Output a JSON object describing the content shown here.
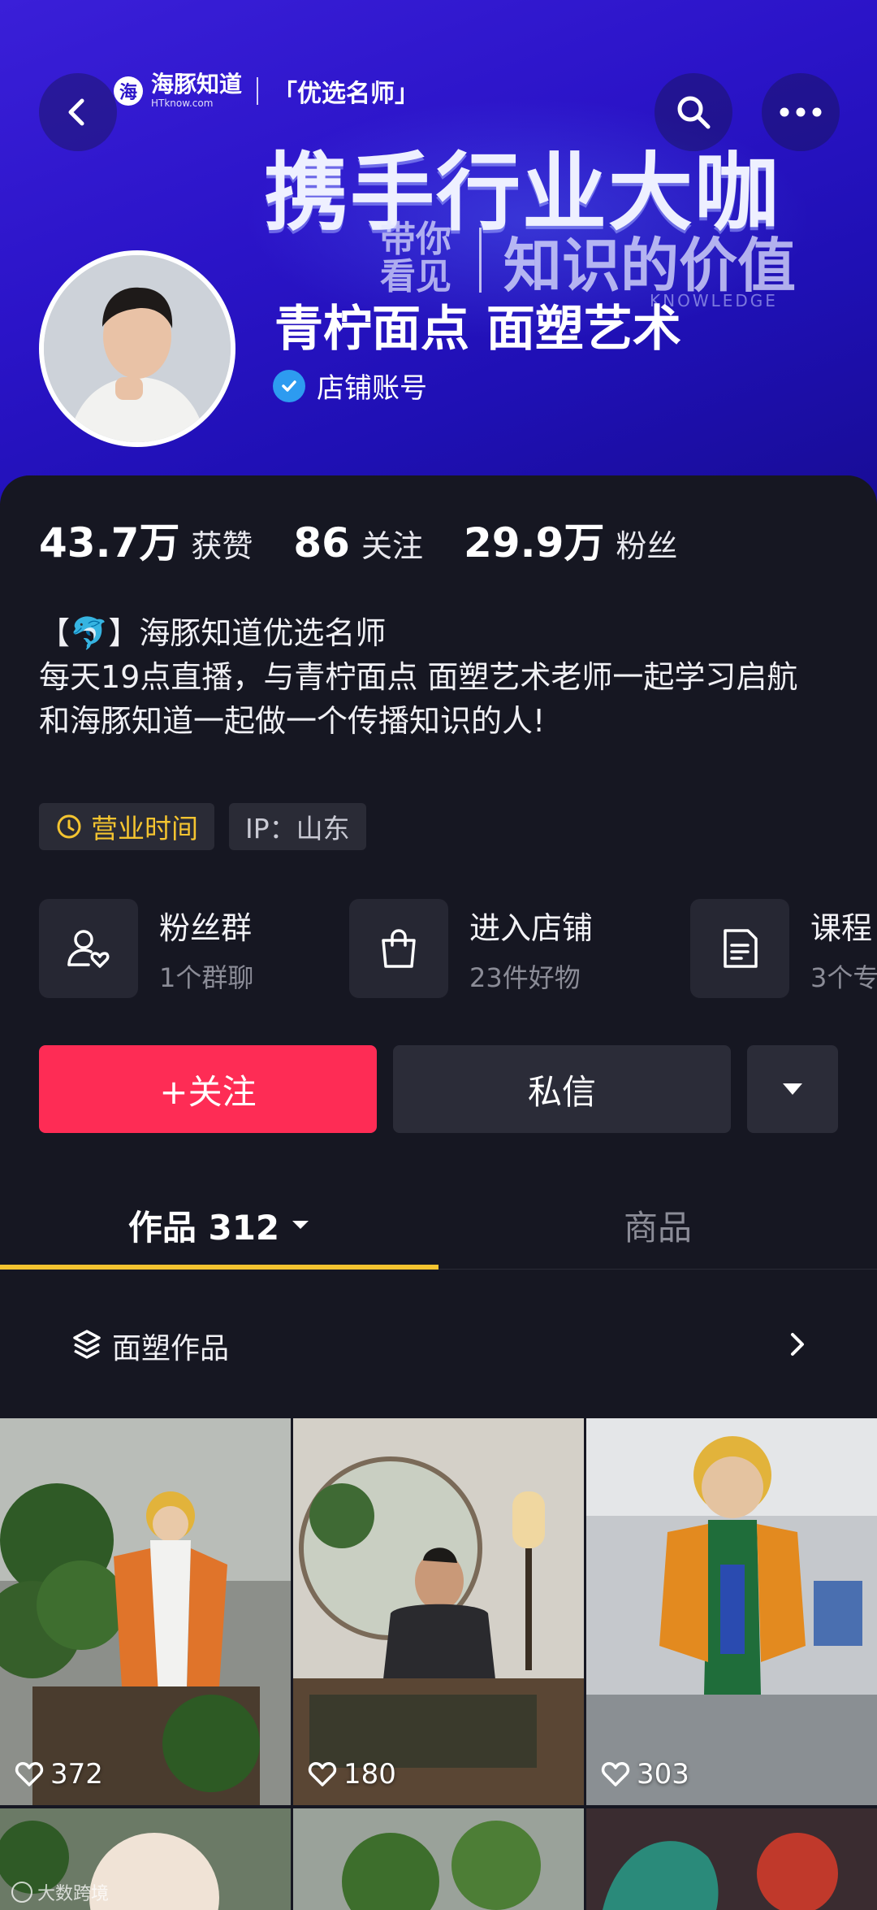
{
  "header": {
    "brand_logo_glyph": "海",
    "brand_name": "海豚知道",
    "brand_sub": "HTknow.com",
    "brand_tag": "「优选名师」",
    "headline": "携手行业大咖",
    "sub_left": "带你看见",
    "sub_right": "知识的价值",
    "sub_knowledge": "KNOWLEDGE"
  },
  "profile": {
    "name": "青柠面点 面塑艺术",
    "account_type": "店铺账号"
  },
  "stats": [
    {
      "value": "43.7万",
      "label": "获赞"
    },
    {
      "value": "86",
      "label": "关注"
    },
    {
      "value": "29.9万",
      "label": "粉丝"
    }
  ],
  "bio": {
    "line1": "【🐬】海豚知道优选名师",
    "line2": "每天19点直播，与青柠面点 面塑艺术老师一起学习启航",
    "line3": "和海豚知道一起做一个传播知识的人!"
  },
  "tags": {
    "hours": "营业时间",
    "ip": "IP：山东"
  },
  "features": [
    {
      "title": "粉丝群",
      "sub": "1个群聊",
      "icon": "fan-group-icon"
    },
    {
      "title": "进入店铺",
      "sub": "23件好物",
      "icon": "shopping-bag-icon"
    },
    {
      "title": "课程",
      "sub": "3个专",
      "icon": "course-icon"
    }
  ],
  "actions": {
    "follow": "+关注",
    "message": "私信"
  },
  "tabs": {
    "works": "作品 312",
    "goods": "商品"
  },
  "collection": {
    "label": "面塑作品"
  },
  "videos": [
    {
      "likes": "372"
    },
    {
      "likes": "180"
    },
    {
      "likes": "303"
    }
  ],
  "watermark": "大数跨境",
  "colors": {
    "follow": "#fe2c55",
    "accent": "#f4c430",
    "background": "#161722",
    "banner": "#2b14c8"
  }
}
